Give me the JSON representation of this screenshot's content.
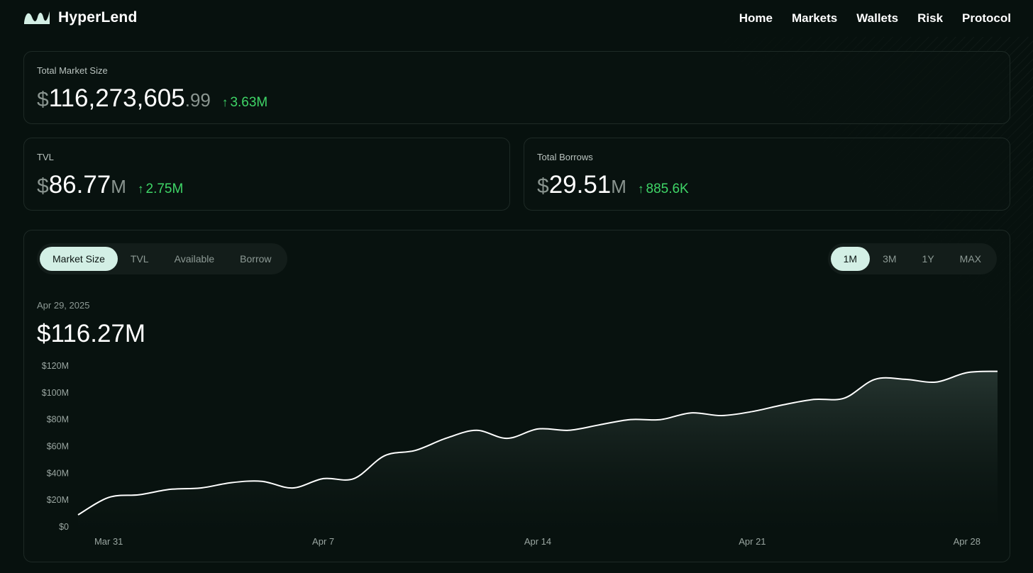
{
  "brand": {
    "name": "HyperLend"
  },
  "nav": [
    "Home",
    "Markets",
    "Wallets",
    "Risk",
    "Protocol"
  ],
  "market_size": {
    "label": "Total Market Size",
    "currency": "$",
    "integer": "116,273,605",
    "decimal": ".99",
    "delta": "3.63M"
  },
  "tvl": {
    "label": "TVL",
    "currency": "$",
    "value": "86.77",
    "unit": "M",
    "delta": "2.75M"
  },
  "borrows": {
    "label": "Total Borrows",
    "currency": "$",
    "value": "29.51",
    "unit": "M",
    "delta": "885.6K"
  },
  "chart_tabs": [
    "Market Size",
    "TVL",
    "Available",
    "Borrow"
  ],
  "chart_tab_active": "Market Size",
  "range_tabs": [
    "1M",
    "3M",
    "1Y",
    "MAX"
  ],
  "range_active": "1M",
  "chart_header": {
    "date": "Apr 29, 2025",
    "value": "$116.27M"
  },
  "colors": {
    "accent": "#d3efe5",
    "positive": "#3fd567",
    "line": "#ffffff"
  },
  "chart_data": {
    "type": "area",
    "title": "",
    "xlabel": "",
    "ylabel": "",
    "ylim": [
      0,
      120
    ],
    "y_ticks": [
      0,
      20,
      40,
      60,
      80,
      100,
      120
    ],
    "y_tick_labels": [
      "$0",
      "$20M",
      "$40M",
      "$60M",
      "$80M",
      "$100M",
      "$120M"
    ],
    "x_ticks": [
      "Mar 31",
      "Apr 7",
      "Apr 14",
      "Apr 21",
      "Apr 28"
    ],
    "x": [
      "Mar 30",
      "Mar 31",
      "Apr 1",
      "Apr 2",
      "Apr 3",
      "Apr 4",
      "Apr 5",
      "Apr 6",
      "Apr 7",
      "Apr 8",
      "Apr 9",
      "Apr 10",
      "Apr 11",
      "Apr 12",
      "Apr 13",
      "Apr 14",
      "Apr 15",
      "Apr 16",
      "Apr 17",
      "Apr 18",
      "Apr 19",
      "Apr 20",
      "Apr 21",
      "Apr 22",
      "Apr 23",
      "Apr 24",
      "Apr 25",
      "Apr 26",
      "Apr 27",
      "Apr 28",
      "Apr 29"
    ],
    "series": [
      {
        "values": [
          9,
          22,
          24,
          28,
          29,
          33,
          34,
          29,
          36,
          36,
          53,
          57,
          66,
          72,
          66,
          73,
          72,
          76,
          80,
          80,
          85,
          83,
          86,
          91,
          95,
          96,
          110,
          110,
          108,
          115,
          116
        ]
      }
    ],
    "grid": false,
    "legend": "none"
  }
}
